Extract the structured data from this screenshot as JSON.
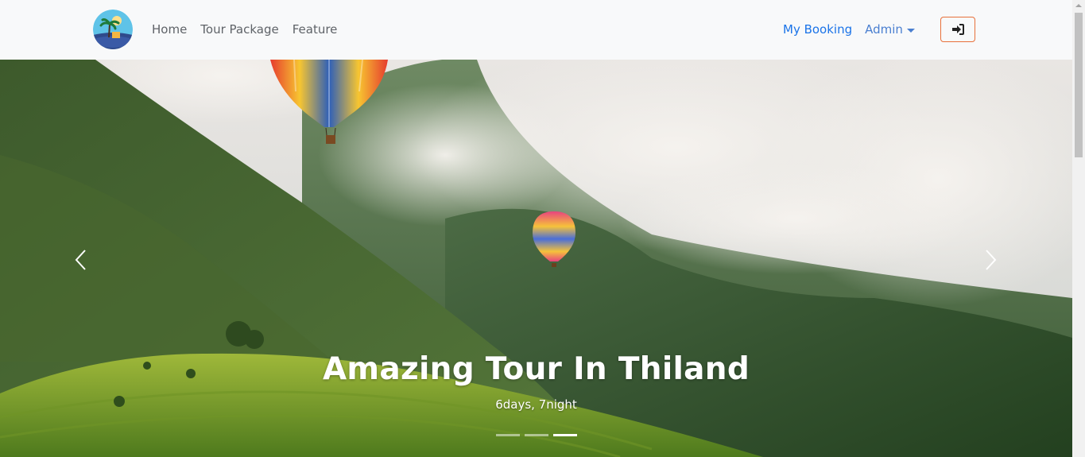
{
  "navbar": {
    "links": [
      "Home",
      "Tour Package",
      "Feature"
    ],
    "my_booking": "My Booking",
    "admin": "Admin"
  },
  "hero": {
    "title": "Amazing Tour In Thiland",
    "subtitle": "6days, 7night",
    "slide_count": 3,
    "active_slide": 3
  },
  "colors": {
    "navbar_bg": "#f8f9fa",
    "link_active": "#1a73e8",
    "login_border": "#e8703a"
  }
}
